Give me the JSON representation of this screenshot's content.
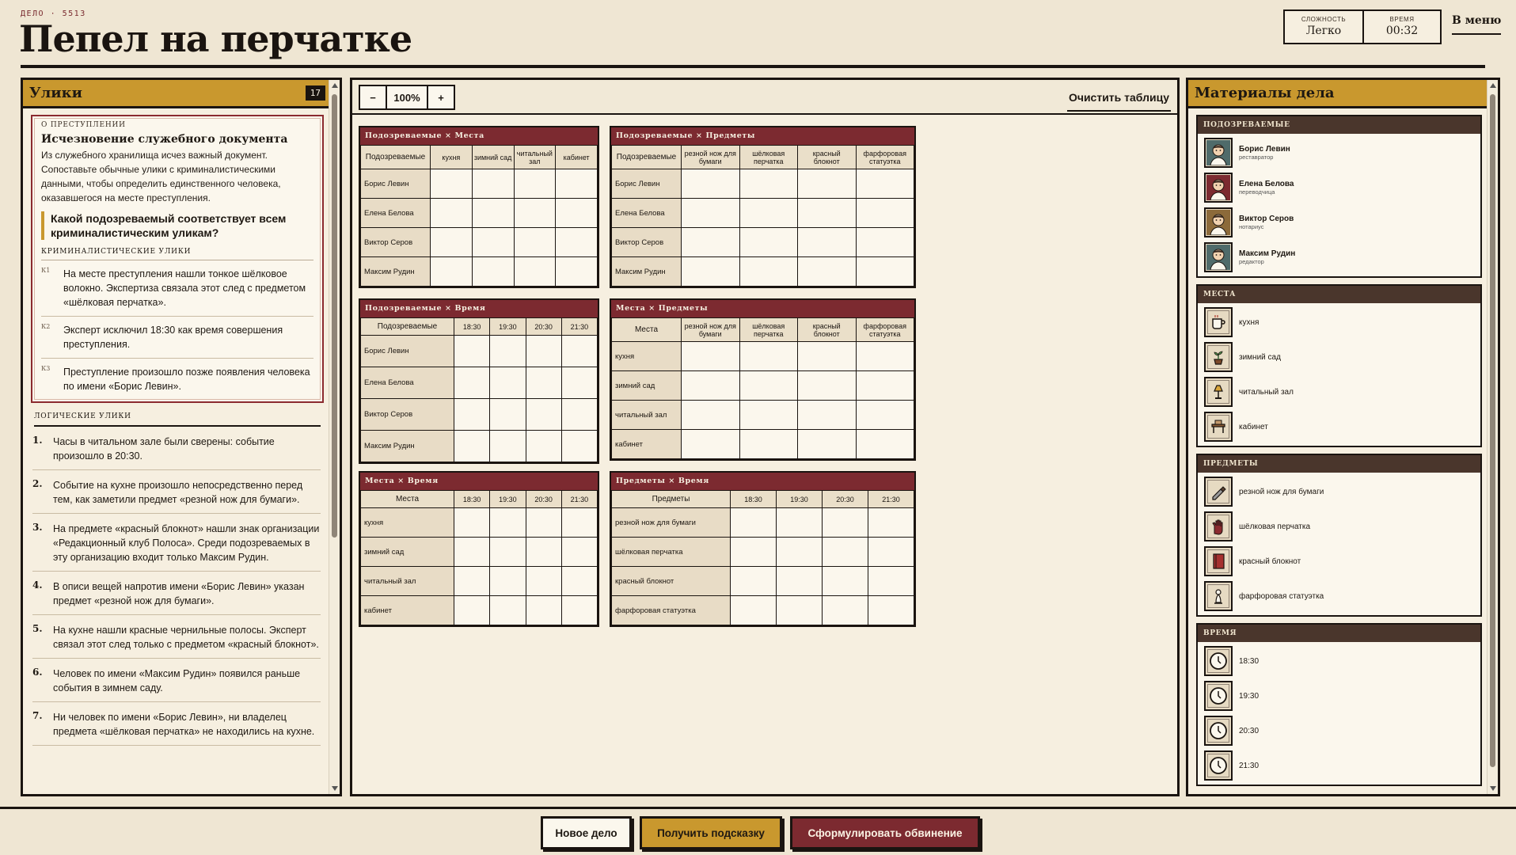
{
  "header": {
    "case_label": "ДЕЛО · 5513",
    "title": "Пепел на перчатке",
    "difficulty_label": "СЛОЖНОСТЬ",
    "difficulty_value": "Легко",
    "time_label": "ВРЕМЯ",
    "time_value": "00:32",
    "menu_label": "В меню"
  },
  "clues_panel": {
    "title": "Улики",
    "count": "17",
    "crime_label": "О ПРЕСТУПЛЕНИИ",
    "crime_title": "Исчезновение служебного документа",
    "crime_desc": "Из служебного хранилища исчез важный документ. Сопоставьте обычные улики с криминалистическими данными, чтобы определить единственного человека, оказавшегося на месте преступления.",
    "question": "Какой подозреваемый соответствует всем криминалистическим уликам?",
    "forensic_label": "КРИМИНАЛИСТИЧЕСКИЕ УЛИКИ",
    "forensic": [
      {
        "tag": "К1",
        "text": "На месте преступления нашли тонкое шёлковое волокно. Экспертиза связала этот след с предметом «шёлковая перчатка»."
      },
      {
        "tag": "К2",
        "text": "Эксперт исключил 18:30 как время совершения преступления."
      },
      {
        "tag": "К3",
        "text": "Преступление произошло позже появления человека по имени «Борис Левин»."
      }
    ],
    "logic_label": "ЛОГИЧЕСКИЕ УЛИКИ",
    "logic": [
      {
        "num": "1.",
        "text": "Часы в читальном зале были сверены: событие произошло в 20:30."
      },
      {
        "num": "2.",
        "text": "Событие на кухне произошло непосредственно перед тем, как заметили предмет «резной нож для бумаги»."
      },
      {
        "num": "3.",
        "text": "На предмете «красный блокнот» нашли знак организации «Редакционный клуб Полоса». Среди подозреваемых в эту организацию входит только Максим Рудин."
      },
      {
        "num": "4.",
        "text": "В описи вещей напротив имени «Борис Левин» указан предмет «резной нож для бумаги»."
      },
      {
        "num": "5.",
        "text": "На кухне нашли красные чернильные полосы. Эксперт связал этот след только с предметом «красный блокнот»."
      },
      {
        "num": "6.",
        "text": "Человек по имени «Максим Рудин» появился раньше события в зимнем саду."
      },
      {
        "num": "7.",
        "text": "Ни человек по имени «Борис Левин», ни владелец предмета «шёлковая перчатка» не находились на кухне."
      }
    ]
  },
  "toolbar": {
    "zoom_out": "−",
    "zoom_value": "100%",
    "zoom_in": "+",
    "clear_label": "Очистить таблицу"
  },
  "grids": {
    "g1": {
      "title": "Подозреваемые × Места",
      "corner": "Подозреваемые",
      "cols": [
        "кухня",
        "зимний сад",
        "читальный зал",
        "кабинет"
      ],
      "rows": [
        "Борис Левин",
        "Елена Белова",
        "Виктор Серов",
        "Максим Рудин"
      ]
    },
    "g2": {
      "title": "Подозреваемые × Предметы",
      "corner": "Подозреваемые",
      "cols": [
        "резной нож для бумаги",
        "шёлковая перчатка",
        "красный блокнот",
        "фарфоровая статуэтка"
      ],
      "rows": [
        "Борис Левин",
        "Елена Белова",
        "Виктор Серов",
        "Максим Рудин"
      ]
    },
    "g3": {
      "title": "Подозреваемые × Время",
      "corner": "Подозреваемые",
      "cols": [
        "18:30",
        "19:30",
        "20:30",
        "21:30"
      ],
      "rows": [
        "Борис Левин",
        "Елена Белова",
        "Виктор Серов",
        "Максим Рудин"
      ]
    },
    "g4": {
      "title": "Места × Предметы",
      "corner": "Места",
      "cols": [
        "резной нож для бумаги",
        "шёлковая перчатка",
        "красный блокнот",
        "фарфоровая статуэтка"
      ],
      "rows": [
        "кухня",
        "зимний сад",
        "читальный зал",
        "кабинет"
      ]
    },
    "g5": {
      "title": "Места × Время",
      "corner": "Места",
      "cols": [
        "18:30",
        "19:30",
        "20:30",
        "21:30"
      ],
      "rows": [
        "кухня",
        "зимний сад",
        "читальный зал",
        "кабинет"
      ]
    },
    "g6": {
      "title": "Предметы × Время",
      "corner": "Предметы",
      "cols": [
        "18:30",
        "19:30",
        "20:30",
        "21:30"
      ],
      "rows": [
        "резной нож для бумаги",
        "шёлковая перчатка",
        "красный блокнот",
        "фарфоровая статуэтка"
      ]
    }
  },
  "materials": {
    "title": "Материалы дела",
    "suspects_label": "ПОДОЗРЕВАЕМЫЕ",
    "suspects": [
      {
        "name": "Борис Левин",
        "role": "реставратор",
        "color": "#4f6b6a"
      },
      {
        "name": "Елена Белова",
        "role": "переводчица",
        "color": "#7c2a30"
      },
      {
        "name": "Виктор Серов",
        "role": "нотариус",
        "color": "#8c6a3a"
      },
      {
        "name": "Максим Рудин",
        "role": "редактор",
        "color": "#4f6b6a"
      }
    ],
    "places_label": "МЕСТА",
    "places": [
      {
        "name": "кухня",
        "icon": "cup-icon"
      },
      {
        "name": "зимний сад",
        "icon": "plant-icon"
      },
      {
        "name": "читальный зал",
        "icon": "lamp-icon"
      },
      {
        "name": "кабинет",
        "icon": "desk-icon"
      }
    ],
    "items_label": "ПРЕДМЕТЫ",
    "items": [
      {
        "name": "резной нож для бумаги",
        "icon": "knife-icon"
      },
      {
        "name": "шёлковая перчатка",
        "icon": "glove-icon"
      },
      {
        "name": "красный блокнот",
        "icon": "notebook-icon"
      },
      {
        "name": "фарфоровая статуэтка",
        "icon": "statuette-icon"
      }
    ],
    "times_label": "ВРЕМЯ",
    "times": [
      "18:30",
      "19:30",
      "20:30",
      "21:30"
    ]
  },
  "footer": {
    "new_case": "Новое дело",
    "hint": "Получить подсказку",
    "accuse": "Сформулировать обвинение"
  },
  "colors": {
    "gold": "#c9982e",
    "maroon": "#7c2a30",
    "ink": "#1a1410",
    "paper": "#fbf7ed"
  }
}
